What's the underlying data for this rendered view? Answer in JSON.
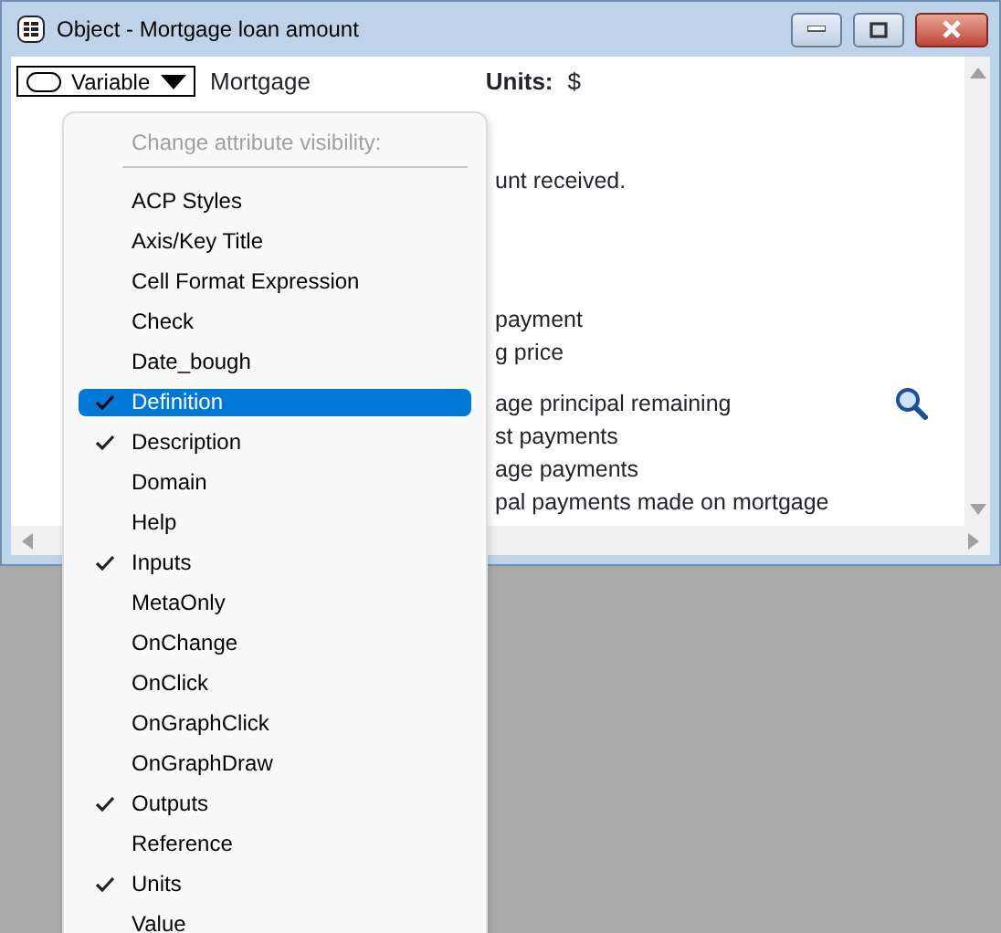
{
  "window": {
    "title": "Object - Mortgage loan amount"
  },
  "header": {
    "class_button": "Variable",
    "identifier": "Mortgage",
    "units_label": "Units:",
    "units_value": "$"
  },
  "body_paragraphs": [
    {
      "lines": [
        {
          "text": "unt received."
        }
      ]
    },
    {
      "lines": [
        {
          "text": "payment"
        },
        {
          "text": "g price"
        }
      ]
    },
    {
      "lines": [
        {
          "text": "age principal remaining",
          "zoom": true
        },
        {
          "text": "st payments"
        },
        {
          "text": "age payments"
        },
        {
          "text": "pal payments made on mortgage"
        }
      ]
    }
  ],
  "menu": {
    "heading": "Change attribute visibility:",
    "items": [
      {
        "label": "ACP Styles",
        "checked": false,
        "selected": false
      },
      {
        "label": "Axis/Key Title",
        "checked": false,
        "selected": false
      },
      {
        "label": "Cell Format Expression",
        "checked": false,
        "selected": false
      },
      {
        "label": "Check",
        "checked": false,
        "selected": false
      },
      {
        "label": "Date_bough",
        "checked": false,
        "selected": false
      },
      {
        "label": "Definition",
        "checked": true,
        "selected": true
      },
      {
        "label": "Description",
        "checked": true,
        "selected": false
      },
      {
        "label": "Domain",
        "checked": false,
        "selected": false
      },
      {
        "label": "Help",
        "checked": false,
        "selected": false
      },
      {
        "label": "Inputs",
        "checked": true,
        "selected": false
      },
      {
        "label": "MetaOnly",
        "checked": false,
        "selected": false
      },
      {
        "label": "OnChange",
        "checked": false,
        "selected": false
      },
      {
        "label": "OnClick",
        "checked": false,
        "selected": false
      },
      {
        "label": "OnGraphClick",
        "checked": false,
        "selected": false
      },
      {
        "label": "OnGraphDraw",
        "checked": false,
        "selected": false
      },
      {
        "label": "Outputs",
        "checked": true,
        "selected": false
      },
      {
        "label": "Reference",
        "checked": false,
        "selected": false
      },
      {
        "label": "Units",
        "checked": true,
        "selected": false
      },
      {
        "label": "Value",
        "checked": false,
        "selected": false
      }
    ]
  }
}
